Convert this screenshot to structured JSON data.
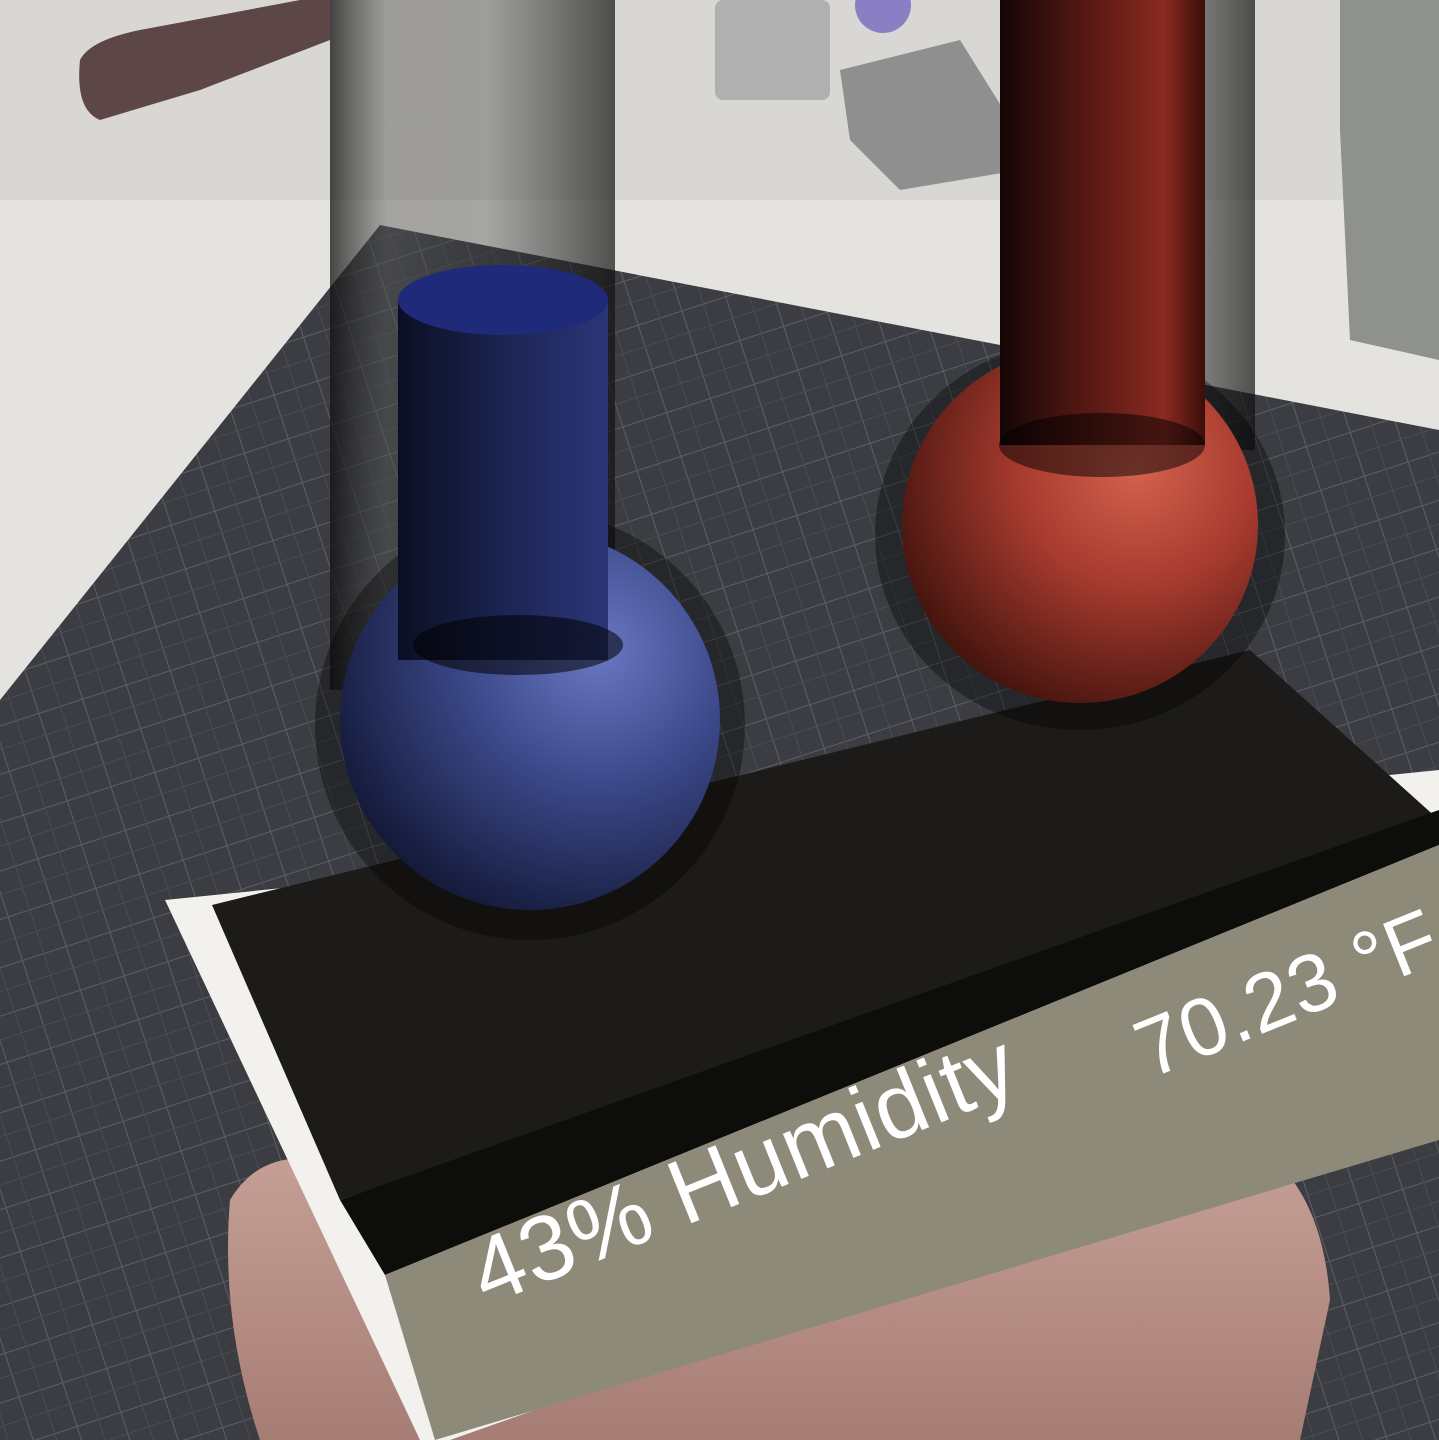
{
  "readouts": {
    "humidity_text": "43% Humidity",
    "temperature_text": "70.23 °F"
  },
  "gauges": {
    "humidity": {
      "percent": 43,
      "color": "#3d4a8c"
    },
    "temperature": {
      "value_f": 70.23,
      "color": "#a63a2e"
    }
  },
  "colors": {
    "base_top": "#1c1b19",
    "base_front": "#0d0d0c",
    "label_panel": "#8d8a7a",
    "cutting_mat": "#3a3c40",
    "table": "#e4e3df"
  },
  "icons": {
    "humidity_gauge": "thermometer-icon",
    "temperature_gauge": "thermometer-icon"
  }
}
